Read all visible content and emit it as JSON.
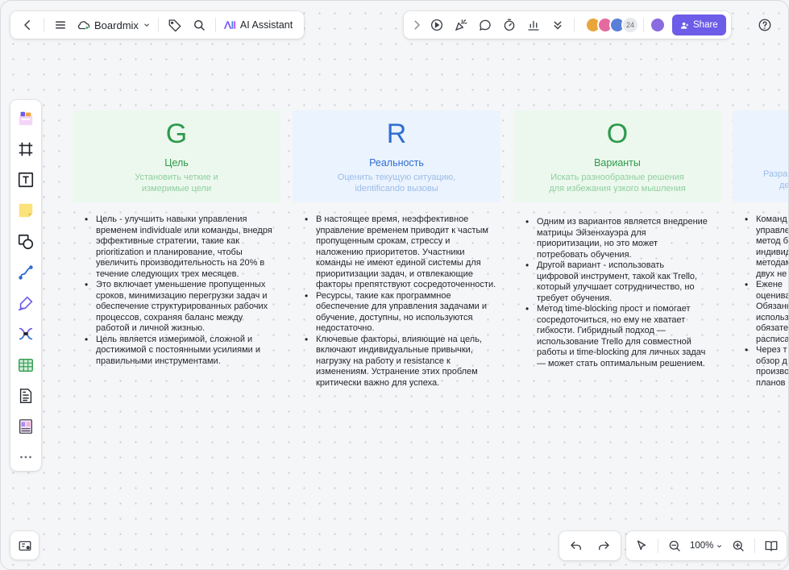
{
  "app": {
    "name": "Boardmix",
    "ai_label": "AI Assistant",
    "share_label": "Share",
    "collaborator_count": "24",
    "zoom": "100%"
  },
  "colors": {
    "accent": "#6d5ce7",
    "green": "#2e9a4c",
    "blue": "#2f6fd0",
    "green_bg": "#ecf8ee",
    "blue_bg": "#ebf3fe"
  },
  "columns": [
    {
      "letter": "G",
      "title": "Цель",
      "subtitle_lines": [
        "Установить четкие и",
        "измеримые цели"
      ],
      "bullets": [
        "Цель - улучшить навыки управления временем individuale или команды, внедря эффективные стратегии, такие как prioritization и планирование, чтобы увеличить производительность на 20% в течение следующих трех месяцев.",
        "Это включает уменьшение пропущенных сроков, минимизацию перегрузки задач и обеспечение структурированных рабочих процессов, сохраняя баланс между работой и личной жизнью.",
        "Цель является измеримой, сложной и достижимой с постоянными усилиями и правильными инструментами."
      ]
    },
    {
      "letter": "R",
      "title": "Реальность",
      "subtitle_lines": [
        "Оценить текущую ситуацию,",
        "identificando вызовы"
      ],
      "bullets": [
        "В настоящее время, неэффективное управление временем приводит к частым пропущенным срокам, стрессу и наложению приоритетов. Участники команды не имеют единой системы для приоритизации задач, и отвлекающие факторы препятствуют сосредоточенности.",
        "Ресурсы, такие как программное обеспечение для управления задачами и обучение, доступны, но используются недостаточно.",
        "Ключевые факторы, влияющие на цель, включают индивидуальные привычки, нагрузку на работу и resistance к изменениям. Устранение этих проблем критически важно для успеха."
      ]
    },
    {
      "letter": "O",
      "title": "Варианты",
      "subtitle_lines": [
        "Искать разнообразные решения",
        "для избежания узкого мышления"
      ],
      "bullets": [
        "Одним из вариантов является внедрение матрицы Эйзенхауэра для приоритизации, но это может потребовать обучения.",
        "Другой вариант - использовать цифровой инструмент, такой как Trello, который улучшает сотрудничество, но требует обучения.",
        "Метод time-blocking прост и помогает сосредоточиться, но ему не хватает гибкости. Гибридный подход — использование Trello для совместной работы и time-blocking для личных задач — может стать оптимальным решением."
      ]
    },
    {
      "letter": "",
      "title": "",
      "subtitle_lines": [
        "Разра",
        "де"
      ],
      "bullets": [
        "Команд управле метод б индивид методам двух не",
        "Ежене оценива Обязанн использ обязате расписа",
        "Через т обзор д производ планов"
      ]
    }
  ]
}
